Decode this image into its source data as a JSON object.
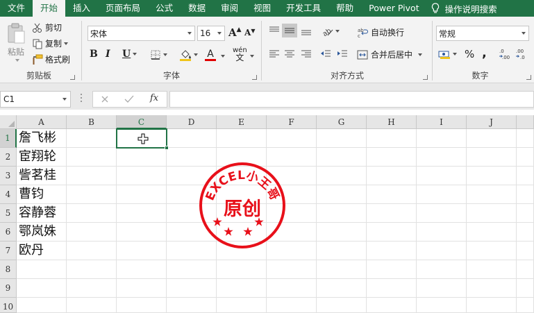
{
  "menu": {
    "tabs": [
      "文件",
      "开始",
      "插入",
      "页面布局",
      "公式",
      "数据",
      "审阅",
      "视图",
      "开发工具",
      "帮助",
      "Power Pivot"
    ],
    "active_tab": "开始",
    "tell_me": "操作说明搜索"
  },
  "ribbon": {
    "clipboard": {
      "label": "剪贴板",
      "paste": "粘贴",
      "cut": "剪切",
      "copy": "复制",
      "format_painter": "格式刷"
    },
    "font": {
      "label": "字体",
      "font_name": "宋体",
      "font_size": "16",
      "bold": "B",
      "italic": "I",
      "underline": "U",
      "grow": "A",
      "shrink": "A",
      "phonetic_top": "wén",
      "phonetic_bottom": "文"
    },
    "alignment": {
      "label": "对齐方式",
      "wrap_text": "自动换行",
      "merge_center": "合并后居中"
    },
    "number": {
      "label": "数字",
      "format": "常规",
      "percent": "%",
      "comma": ","
    }
  },
  "formula_bar": {
    "name_box": "C1",
    "fx": "fx",
    "value": ""
  },
  "grid": {
    "columns": [
      "A",
      "B",
      "C",
      "D",
      "E",
      "F",
      "G",
      "H",
      "I",
      "J"
    ],
    "selected_column": "C",
    "rows": [
      "1",
      "2",
      "3",
      "4",
      "5",
      "6",
      "7",
      "8",
      "9",
      "10"
    ],
    "selected_row": "1",
    "selected_cell": "C1",
    "column_a_values": [
      "詹飞彬",
      "宦翔轮",
      "訾茗桂",
      "曹钧",
      "容静蓉",
      "鄂岚姝",
      "欧丹"
    ]
  },
  "stamp": {
    "arc_text": "EXCEL小王哥",
    "center_text": "原创",
    "color": "#e8101a"
  },
  "colors": {
    "accent": "#217346"
  }
}
